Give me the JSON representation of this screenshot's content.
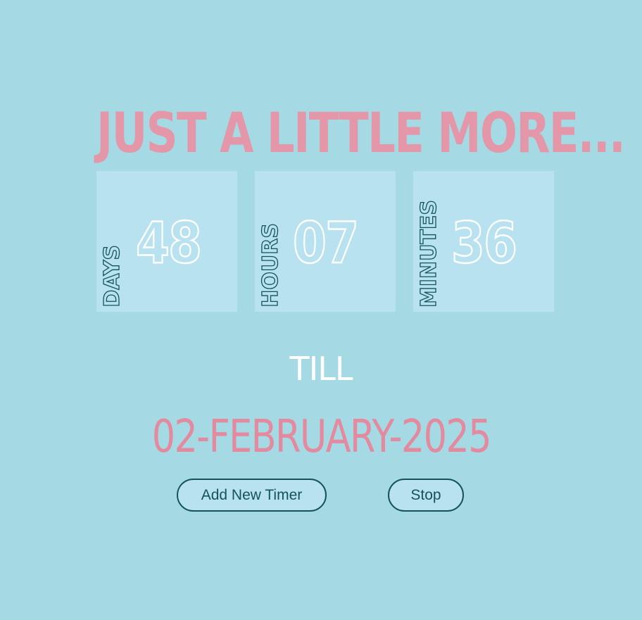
{
  "headline": "JUST A LITTLE MORE...",
  "countdown": [
    {
      "value": "48",
      "unit": "DAYS"
    },
    {
      "value": "07",
      "unit": "HOURS"
    },
    {
      "value": "36",
      "unit": "MINUTES"
    }
  ],
  "till_label": "TILL",
  "target_date": "02-FEBRUARY-2025",
  "buttons": {
    "add_timer": "Add New Timer",
    "stop": "Stop"
  },
  "colors": {
    "background": "#a5d9e3",
    "tile": "#b8e2ef",
    "accent_pink": "#e397a8",
    "dark_teal": "#135457",
    "white": "#ffffff"
  }
}
